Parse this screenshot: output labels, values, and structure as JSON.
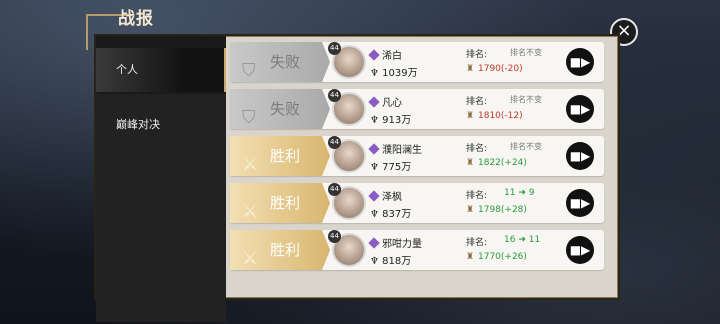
{
  "header": {
    "title": "战报"
  },
  "tabs": [
    {
      "label": "个人"
    },
    {
      "label": "巅峰对决"
    }
  ],
  "rank_label": "排名:",
  "records": [
    {
      "result": "失败",
      "result_type": "lose",
      "level": "44",
      "name": "浠白",
      "power": "1039万",
      "rank_status": "排名不变",
      "rank_from": "",
      "rank_to": "",
      "score": "1790(-20)",
      "score_dir": "down"
    },
    {
      "result": "失败",
      "result_type": "lose",
      "level": "44",
      "name": "凡心",
      "power": "913万",
      "rank_status": "排名不变",
      "rank_from": "",
      "rank_to": "",
      "score": "1810(-12)",
      "score_dir": "down"
    },
    {
      "result": "胜利",
      "result_type": "win",
      "level": "44",
      "name": "濮阳澜生",
      "power": "775万",
      "rank_status": "排名不变",
      "rank_from": "",
      "rank_to": "",
      "score": "1822(+24)",
      "score_dir": "up"
    },
    {
      "result": "胜利",
      "result_type": "win",
      "level": "44",
      "name": "泽枫",
      "power": "837万",
      "rank_status": "",
      "rank_from": "11",
      "rank_to": "9",
      "score": "1798(+28)",
      "score_dir": "up"
    },
    {
      "result": "胜利",
      "result_type": "win",
      "level": "44",
      "name": "邪咁力量",
      "power": "818万",
      "rank_status": "",
      "rank_from": "16",
      "rank_to": "11",
      "score": "1770(+26)",
      "score_dir": "up"
    }
  ],
  "colors": {
    "win": "#d8b66f",
    "lose": "#a9a9a9",
    "up": "#2a9a3a",
    "down": "#c0392b",
    "accent": "#c9a86a"
  },
  "icons": {
    "close": "close-icon",
    "replay": "video-camera-icon",
    "gem": "purple-gem-icon",
    "medal": "medal-icon",
    "power": "power-icon"
  }
}
